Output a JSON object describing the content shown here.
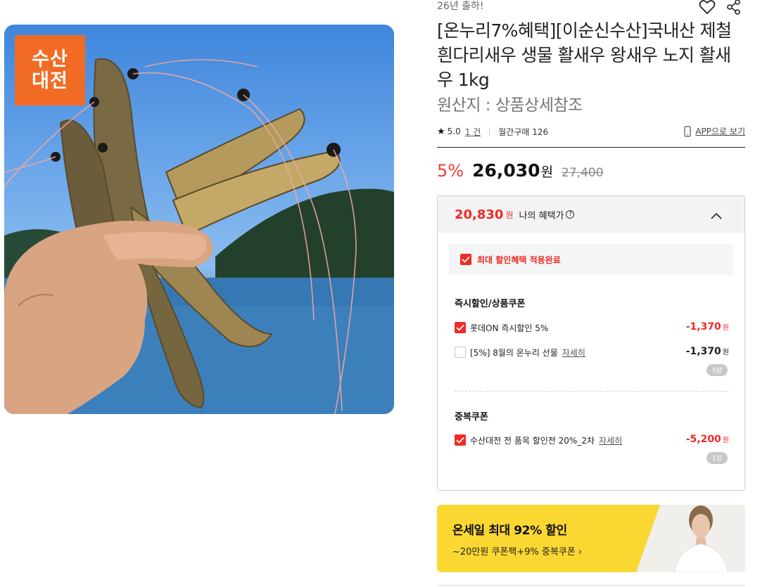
{
  "product_image": {
    "logo_line1": "수산",
    "logo_line2": "대전"
  },
  "header": {
    "shipping_note": "26년 출하!"
  },
  "product": {
    "title": "[온누리7%혜택][이순신수산]국내산 제철 흰다리새우 생물 활새우 왕새우 노지 활새우 1kg",
    "origin": "원산지 : 상품상세참조"
  },
  "rating": {
    "score": "5.0",
    "reviews": "1 건",
    "monthly": "월간구매 126",
    "app_link": "APP으로 보기"
  },
  "price": {
    "discount_rate": "5%",
    "sale": "26,030",
    "won": "원",
    "original": "27,400"
  },
  "benefit": {
    "price": "20,830",
    "won": "원",
    "label": "나의 혜택가",
    "help_icon": "?",
    "applied_label": "최대 할인혜택 적용완료",
    "instant_title": "즉시할인/상품쿠폰",
    "coupons": [
      {
        "label": "롯데ON 즉시할인 5%",
        "amount": "-1,370",
        "unit": "원",
        "checked": true
      },
      {
        "label": "[5%] 8월의 온누리 선물",
        "detail": "자세히",
        "amount": "-1,370",
        "unit": "원",
        "badge": "5장",
        "checked": false
      }
    ],
    "stack_title": "중복쿠폰",
    "stack_coupons": [
      {
        "label": "수산대전 전 품목 할인전 20%_2차",
        "detail": "자세히",
        "amount": "-5,200",
        "unit": "원",
        "badge": "1장",
        "checked": true
      }
    ]
  },
  "banner": {
    "title": "온세일 최대 92% 할인",
    "subtitle": "~20만원 쿠폰팩+9% 중복쿠폰 ›"
  },
  "colors": {
    "accent_red": "#ef2b23",
    "banner_yellow": "#fbd731",
    "logo_orange": "#f26b24"
  },
  "icons": [
    "heart-icon",
    "share-icon",
    "star-icon",
    "phone-icon",
    "chevron-up-icon",
    "help-icon",
    "check-icon"
  ]
}
